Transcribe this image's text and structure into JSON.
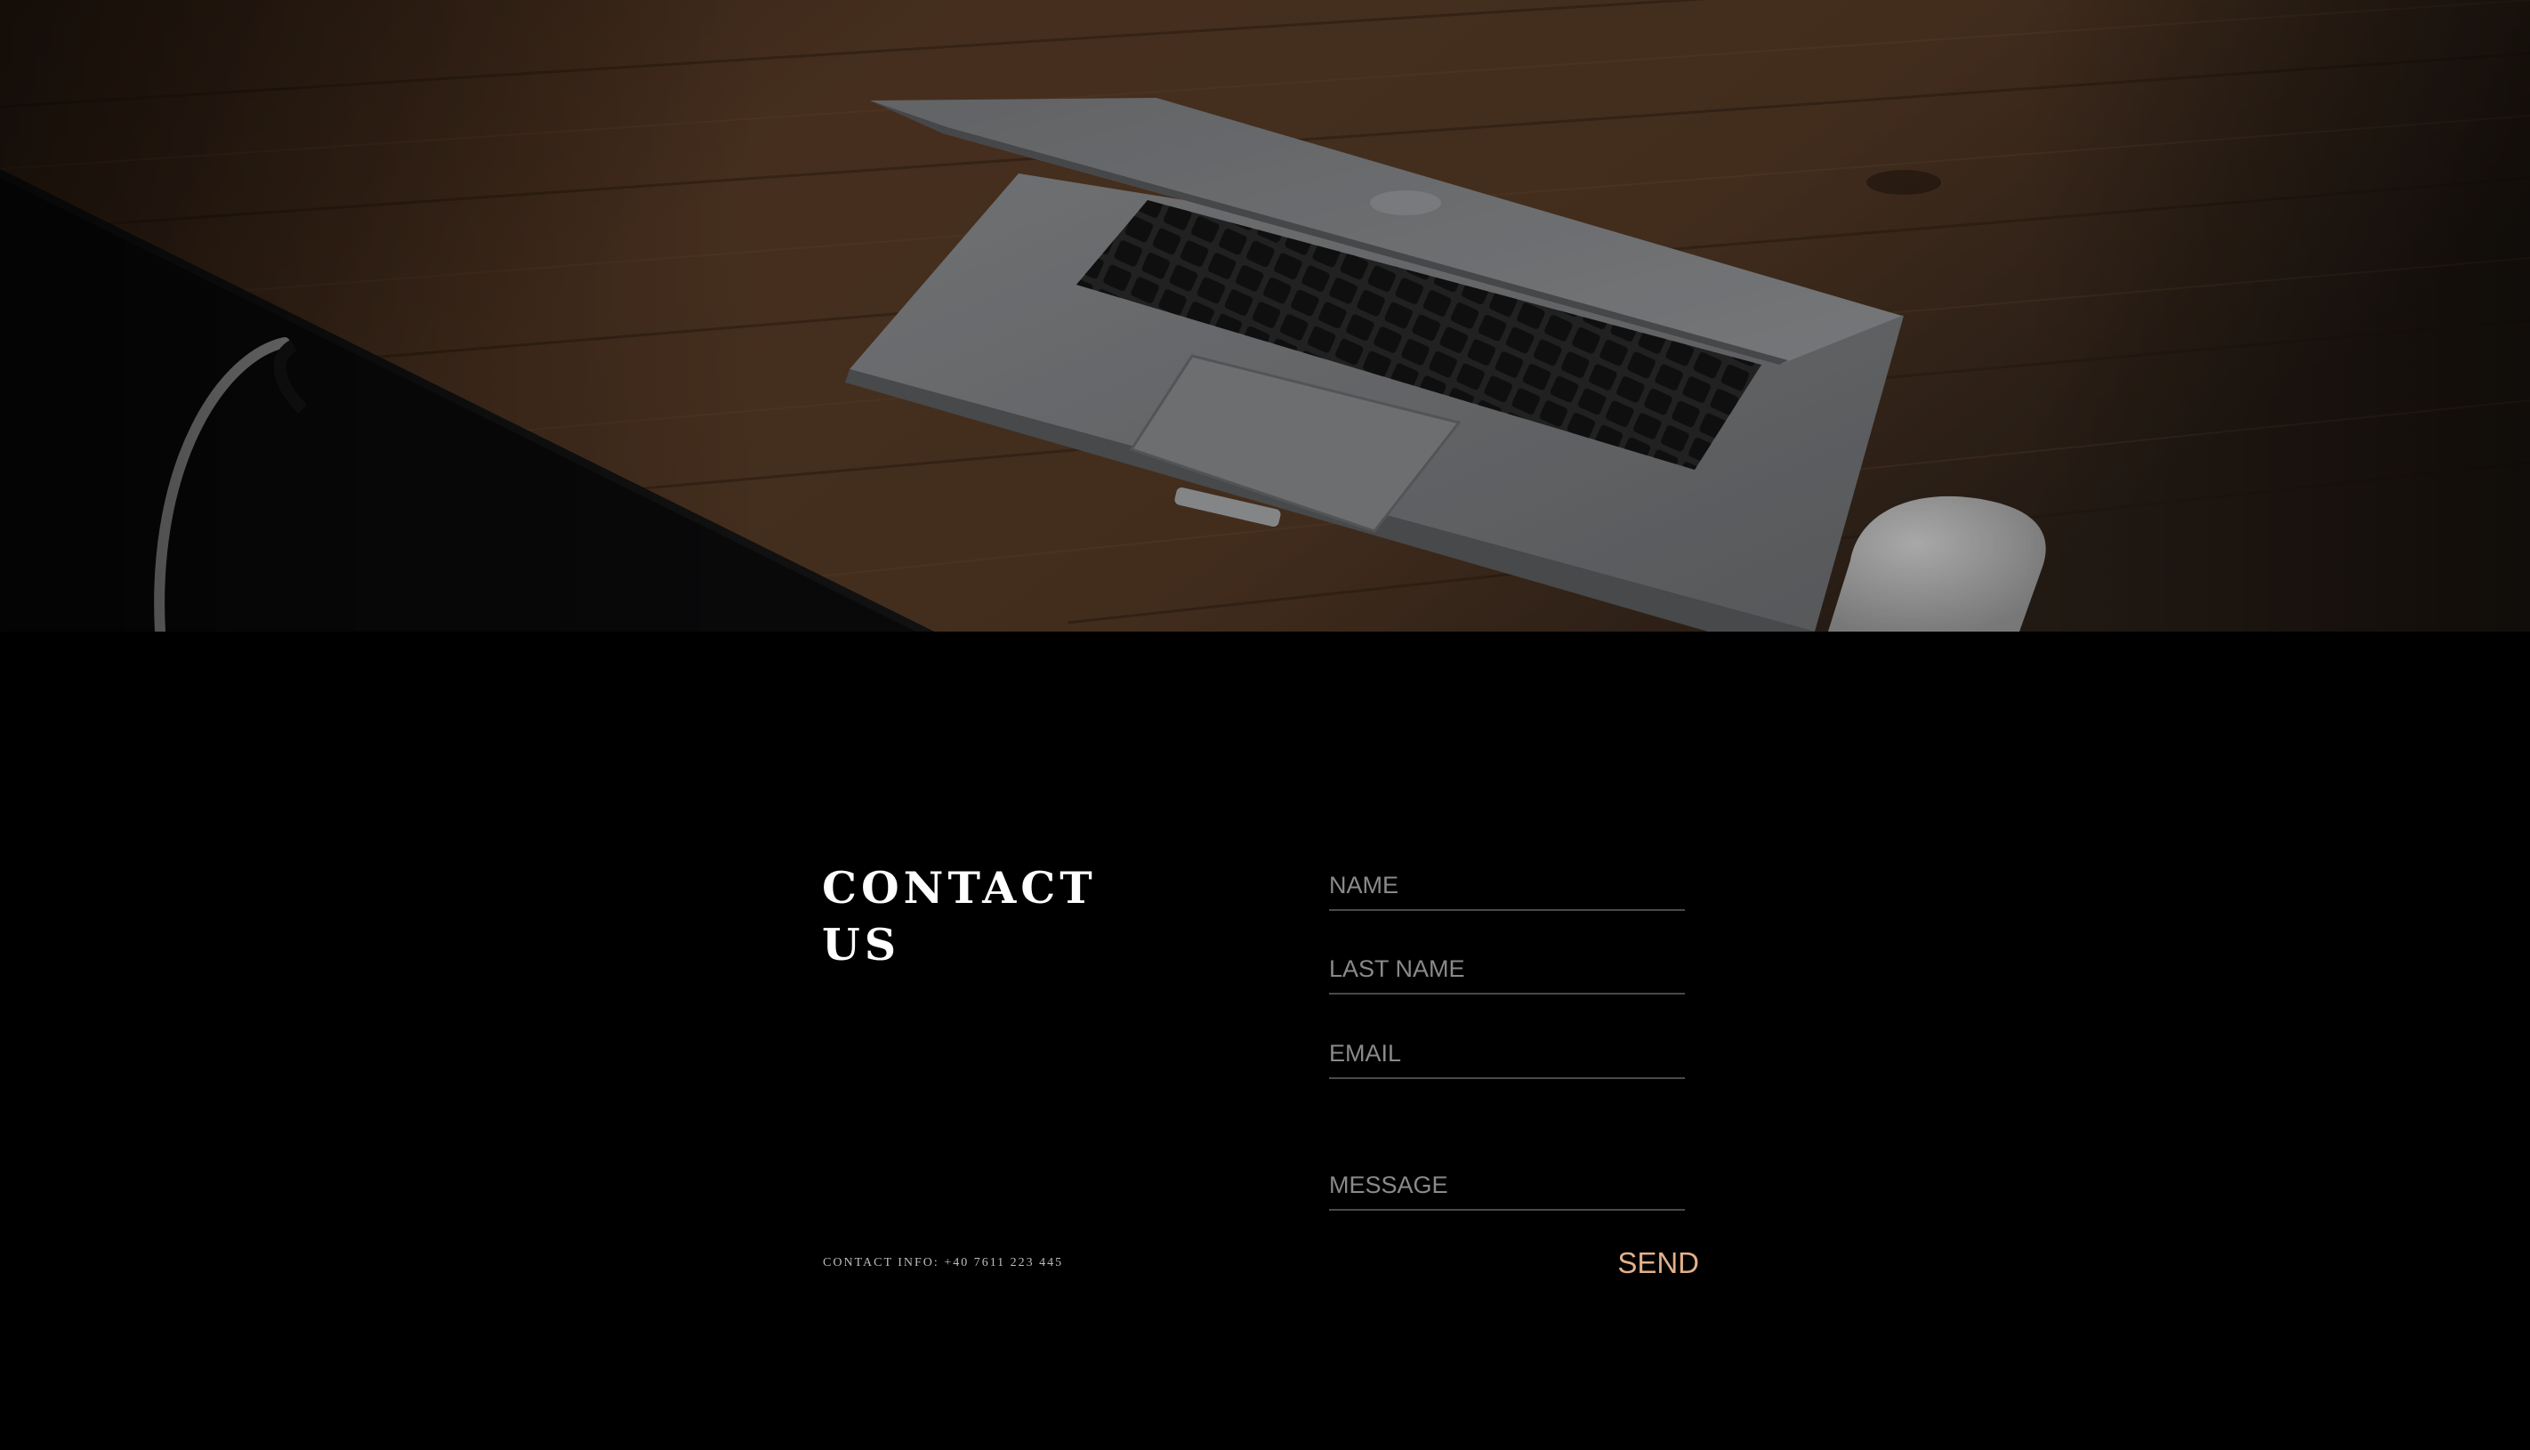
{
  "hero": {
    "image": "laptop-on-wooden-desk-photo"
  },
  "contact": {
    "heading_line1": "CONTACT",
    "heading_line2": "US",
    "info": "CONTACT INFO: +40 7611 223 445",
    "form": {
      "name_placeholder": "NAME",
      "lastname_placeholder": "LAST NAME",
      "email_placeholder": "EMAIL",
      "message_placeholder": "MESSAGE",
      "send_label": "SEND"
    }
  },
  "colors": {
    "background": "#000000",
    "heading": "#ffffff",
    "placeholder": "#8a8a8a",
    "underline": "#4a4a4a",
    "send_accent": "#e3b08a"
  }
}
